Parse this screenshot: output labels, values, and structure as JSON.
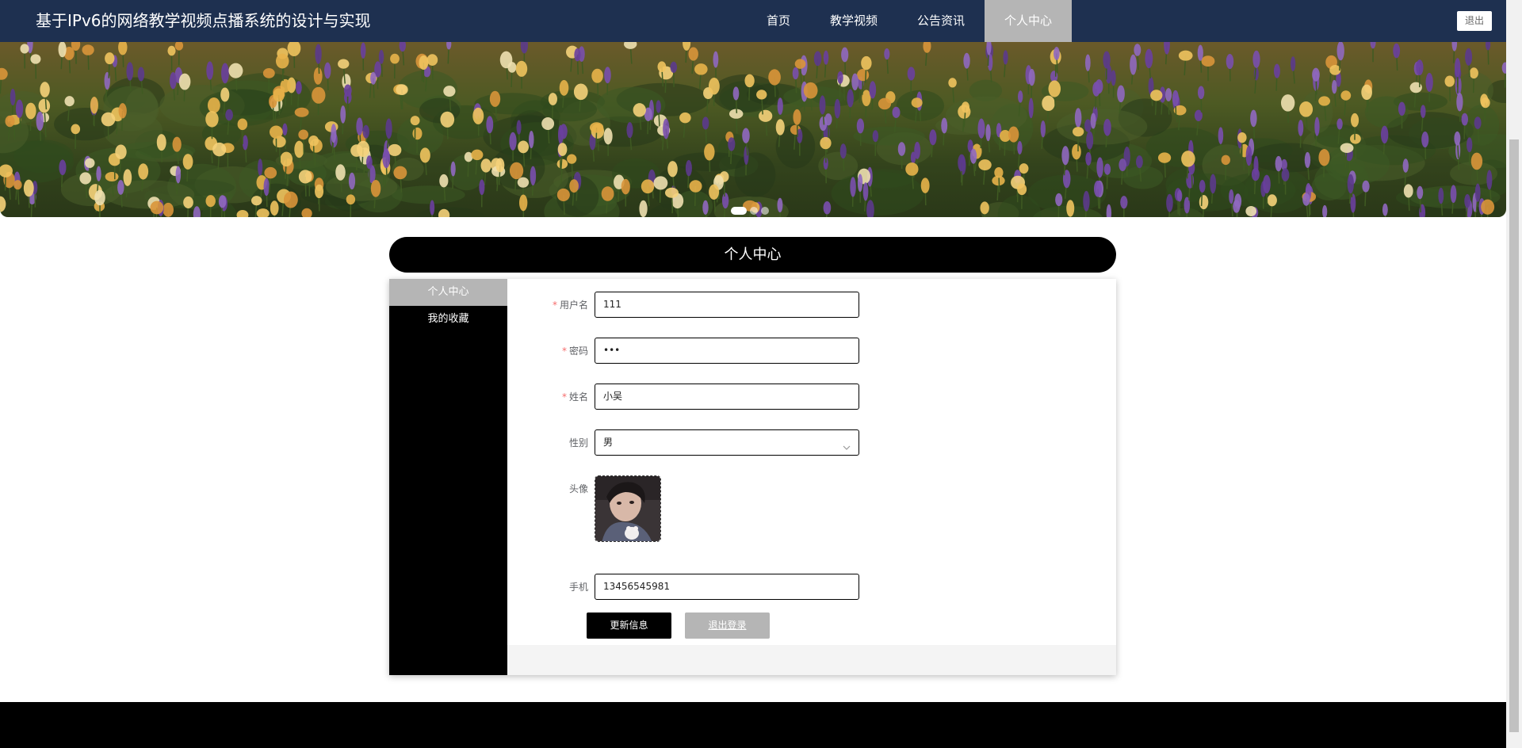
{
  "header": {
    "site_title": "基于IPv6的网络教学视频点播系统的设计与实现",
    "nav": [
      {
        "label": "首页"
      },
      {
        "label": "教学视频"
      },
      {
        "label": "公告资讯"
      },
      {
        "label": "个人中心"
      }
    ],
    "active_nav": "个人中心",
    "logout_label": "退出"
  },
  "banner": {
    "image": "wildflower-meadow",
    "carousel_slides": 3,
    "active_slide": 1
  },
  "section": {
    "title": "个人中心"
  },
  "sidebar": {
    "items": [
      {
        "label": "个人中心",
        "active": true
      },
      {
        "label": "我的收藏",
        "active": false
      }
    ]
  },
  "form": {
    "username": {
      "label": "用户名",
      "required": true,
      "value": "111"
    },
    "password": {
      "label": "密码",
      "required": true,
      "value": "•••"
    },
    "name": {
      "label": "姓名",
      "required": true,
      "value": "小吴"
    },
    "gender": {
      "label": "性别",
      "value": "男"
    },
    "avatar": {
      "label": "头像"
    },
    "phone": {
      "label": "手机",
      "value": "13456545981"
    },
    "required_mark": "*",
    "update_button": "更新信息",
    "logout_button": "退出登录"
  },
  "colors": {
    "header_bg": "#1e3050",
    "active_nav_bg": "#b5b5b5",
    "sidebar_bg": "#000000",
    "required": "#f56c6c"
  }
}
